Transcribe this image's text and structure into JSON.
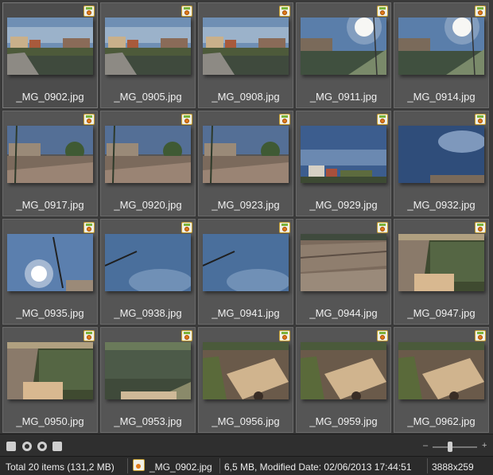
{
  "grid": {
    "items": [
      {
        "name": "_MG_0902.jpg",
        "scene": "canal",
        "selected": true
      },
      {
        "name": "_MG_0905.jpg",
        "scene": "canal"
      },
      {
        "name": "_MG_0908.jpg",
        "scene": "canal"
      },
      {
        "name": "_MG_0911.jpg",
        "scene": "canal-sun"
      },
      {
        "name": "_MG_0914.jpg",
        "scene": "canal-sun"
      },
      {
        "name": "_MG_0917.jpg",
        "scene": "street"
      },
      {
        "name": "_MG_0920.jpg",
        "scene": "street"
      },
      {
        "name": "_MG_0923.jpg",
        "scene": "street"
      },
      {
        "name": "_MG_0929.jpg",
        "scene": "sky-buildings"
      },
      {
        "name": "_MG_0932.jpg",
        "scene": "sky"
      },
      {
        "name": "_MG_0935.jpg",
        "scene": "sun-lamp"
      },
      {
        "name": "_MG_0938.jpg",
        "scene": "sky-lamp"
      },
      {
        "name": "_MG_0941.jpg",
        "scene": "sky-lamp"
      },
      {
        "name": "_MG_0944.jpg",
        "scene": "bridge"
      },
      {
        "name": "_MG_0947.jpg",
        "scene": "bridge-water"
      },
      {
        "name": "_MG_0950.jpg",
        "scene": "bridge-water"
      },
      {
        "name": "_MG_0953.jpg",
        "scene": "water-ledge"
      },
      {
        "name": "_MG_0956.jpg",
        "scene": "bridge-down"
      },
      {
        "name": "_MG_0959.jpg",
        "scene": "bridge-down"
      },
      {
        "name": "_MG_0962.jpg",
        "scene": "bridge-down"
      }
    ]
  },
  "toolbar": {
    "buttons": [
      "view-icon",
      "rotate-left-icon",
      "rotate-right-icon",
      "slideshow-icon"
    ],
    "zoom_minus": "–",
    "zoom_plus": "+",
    "zoom_level": 0.4
  },
  "status": {
    "total": "Total 20 items  (131,2 MB)",
    "file": "_MG_0902.jpg",
    "info": "6,5 MB, Modified Date: 02/06/2013 17:44:51",
    "dims": "3888x259"
  },
  "colors": {
    "background": "#3a3a3a",
    "tile": "#555555",
    "badge_orange": "#e07a1a",
    "badge_green": "#7ab33a"
  }
}
